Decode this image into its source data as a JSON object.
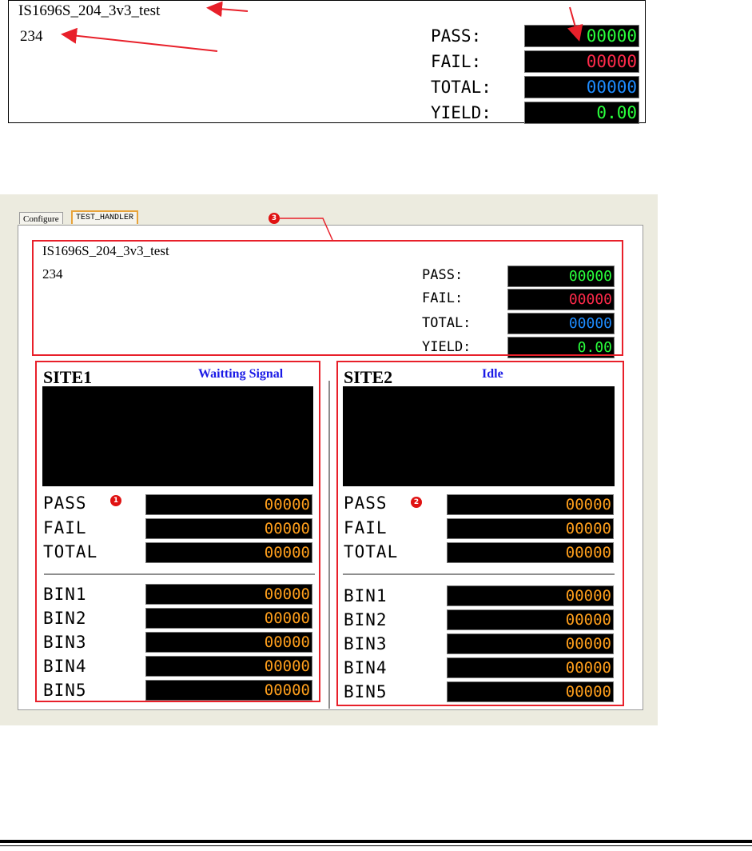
{
  "zoom_panel": {
    "test_name": "IS1696S_204_3v3_test",
    "lot_id": "234",
    "pass_label": "PASS:",
    "pass_value": "00000",
    "fail_label": "FAIL:",
    "fail_value": "00000",
    "total_label": "TOTAL:",
    "total_value": "00000",
    "yield_label": "YIELD:",
    "yield_value": "0.00"
  },
  "app": {
    "tabs": [
      {
        "label": "Configure",
        "active": false
      },
      {
        "label": "TEST_HANDLER",
        "active": true
      }
    ],
    "summary": {
      "test_name": "IS1696S_204_3v3_test",
      "lot_id": "234",
      "pass_label": "PASS:",
      "pass_value": "00000",
      "fail_label": "FAIL:",
      "fail_value": "00000",
      "total_label": "TOTAL:",
      "total_value": "00000",
      "yield_label": "YIELD:",
      "yield_value": "0.00"
    },
    "sites": [
      {
        "title": "SITE1",
        "status": "Waitting Signal",
        "pass_label": "PASS",
        "pass_value": "00000",
        "fail_label": "FAIL",
        "fail_value": "00000",
        "total_label": "TOTAL",
        "total_value": "00000",
        "bins": [
          {
            "label": "BIN1",
            "value": "00000"
          },
          {
            "label": "BIN2",
            "value": "00000"
          },
          {
            "label": "BIN3",
            "value": "00000"
          },
          {
            "label": "BIN4",
            "value": "00000"
          },
          {
            "label": "BIN5",
            "value": "00000"
          }
        ]
      },
      {
        "title": "SITE2",
        "status": "Idle",
        "pass_label": "PASS",
        "pass_value": "00000",
        "fail_label": "FAIL",
        "fail_value": "00000",
        "total_label": "TOTAL",
        "total_value": "00000",
        "bins": [
          {
            "label": "BIN1",
            "value": "00000"
          },
          {
            "label": "BIN2",
            "value": "00000"
          },
          {
            "label": "BIN3",
            "value": "00000"
          },
          {
            "label": "BIN4",
            "value": "00000"
          },
          {
            "label": "BIN5",
            "value": "00000"
          }
        ]
      }
    ]
  },
  "callouts": [
    "1",
    "2",
    "3"
  ],
  "colors": {
    "annotation": "#e8202a",
    "pass": "#2aff3c",
    "fail": "#ff2a4a",
    "total": "#1e8cff",
    "site_counter": "#ff9f1c",
    "status": "#1a1ae6",
    "window_bg": "#ecebdf"
  }
}
